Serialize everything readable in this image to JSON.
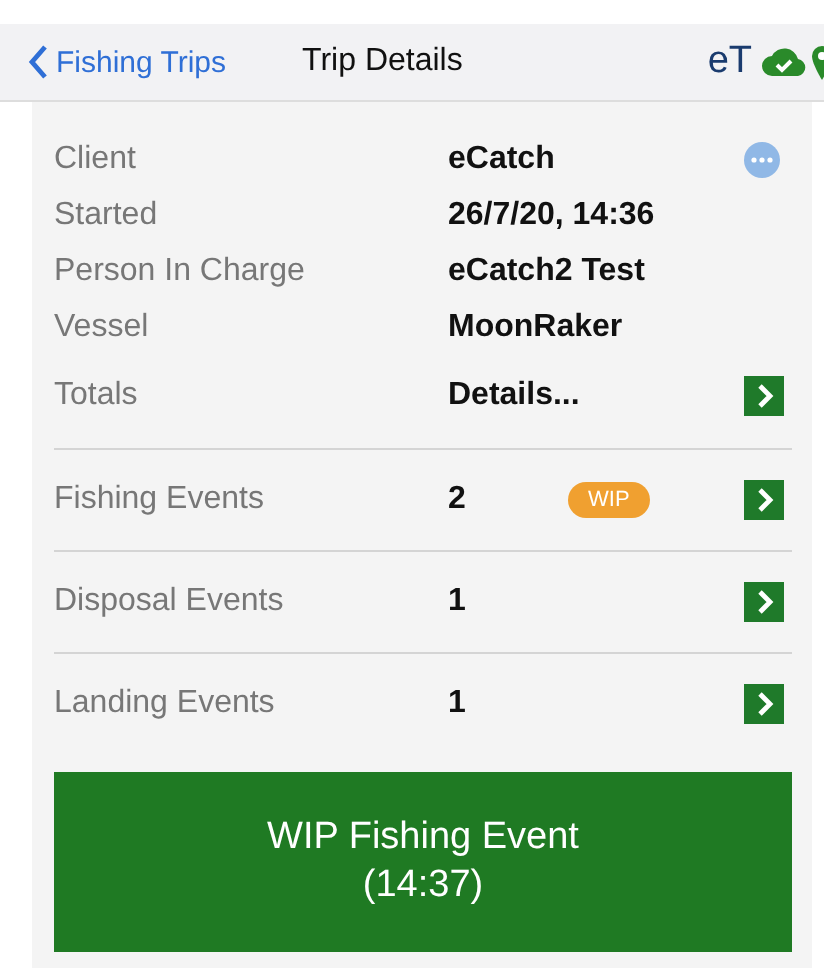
{
  "nav": {
    "back_label": "Fishing Trips",
    "title": "Trip Details",
    "brand": "eT"
  },
  "info": [
    {
      "label": "Client",
      "value": "eCatch",
      "more": true
    },
    {
      "label": "Started",
      "value": "26/7/20, 14:36",
      "more": false
    },
    {
      "label": "Person In Charge",
      "value": "eCatch2 Test",
      "more": false
    },
    {
      "label": "Vessel",
      "value": "MoonRaker",
      "more": false
    }
  ],
  "rows": [
    {
      "label": "Totals",
      "value": "Details...",
      "divider": false
    },
    {
      "label": "Fishing Events",
      "value": "2",
      "badge": "WIP",
      "divider": true
    },
    {
      "label": "Disposal Events",
      "value": "1",
      "divider": true
    },
    {
      "label": "Landing Events",
      "value": "1",
      "divider": true
    }
  ],
  "action": {
    "line1": "WIP Fishing Event",
    "line2": "(14:37)"
  }
}
